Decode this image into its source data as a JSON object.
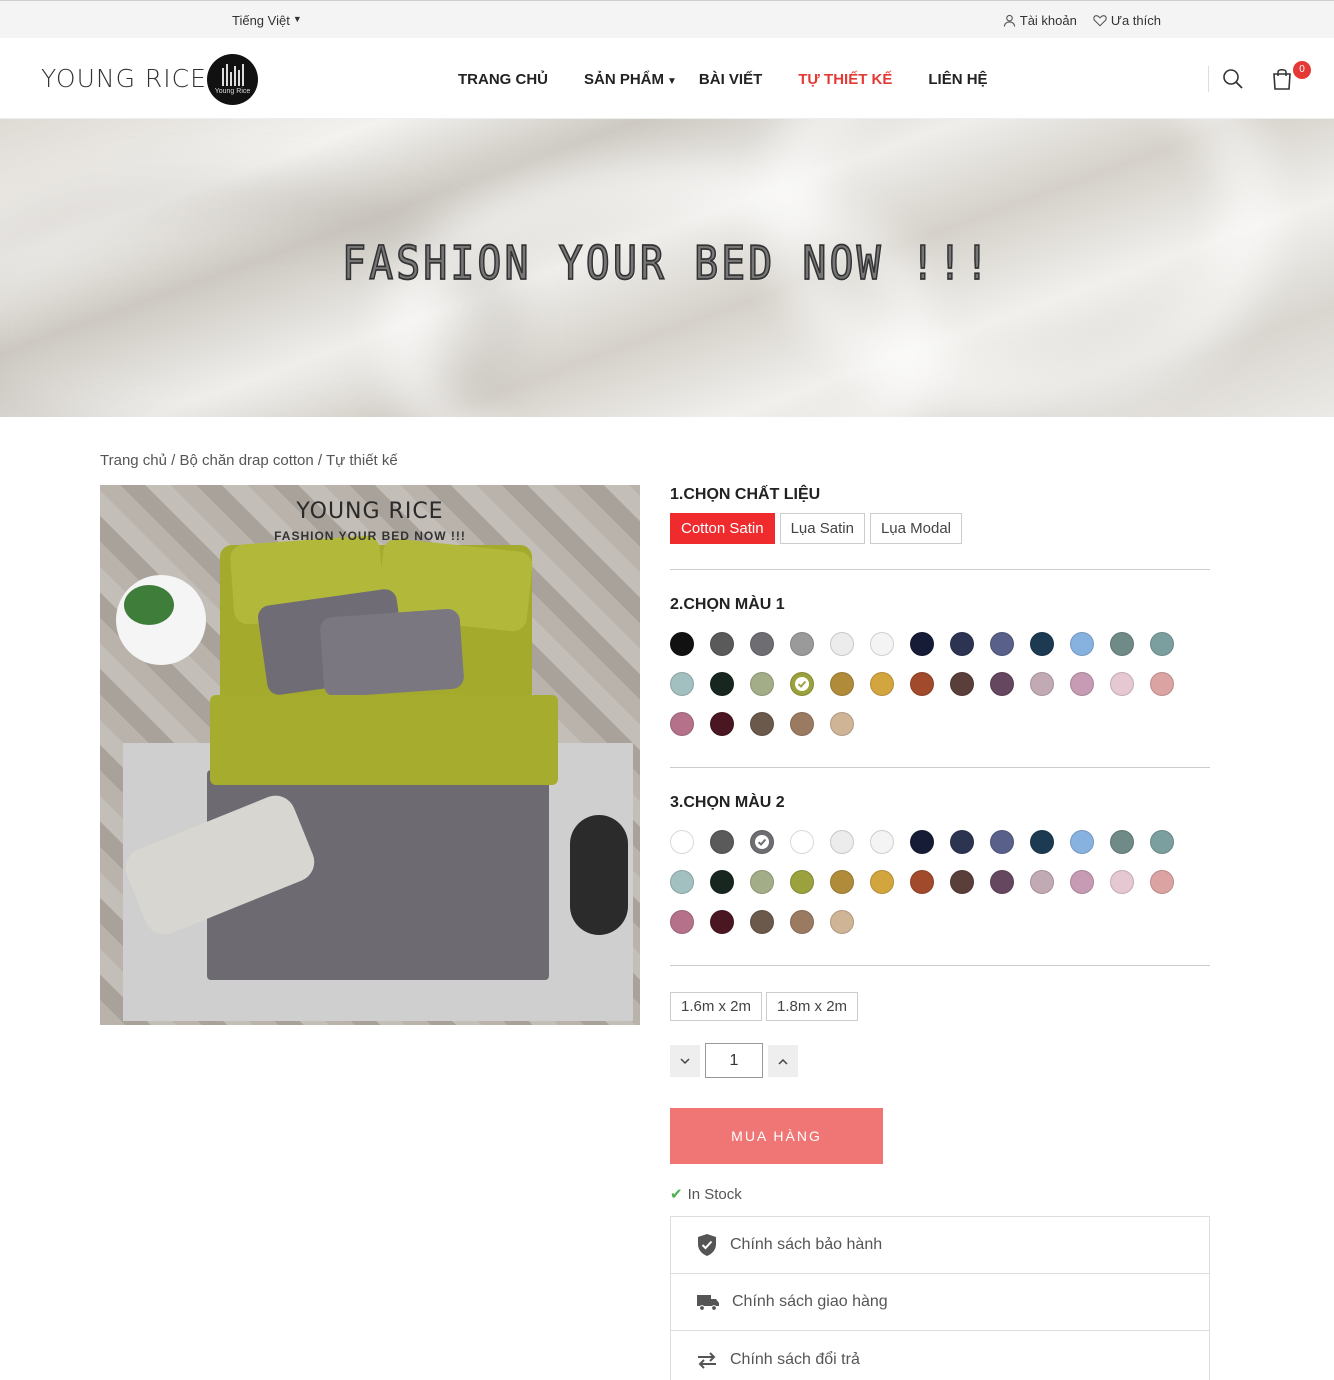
{
  "topbar": {
    "language": "Tiếng Việt",
    "account": "Tài khoản",
    "wishlist": "Ưa thích"
  },
  "header": {
    "logo_text": "YOUNG RICE",
    "logo_sub": "Young Rice",
    "nav": [
      "TRANG CHỦ",
      "SẢN PHẨM",
      "BÀI VIẾT",
      "TỰ THIẾT KẾ",
      "LIÊN HỆ"
    ],
    "active_nav": "TỰ THIẾT KẾ",
    "cart_count": "0",
    "icons": [
      "search-icon",
      "cart-icon"
    ]
  },
  "hero": {
    "title": "FASHION YOUR BED NOW !!!"
  },
  "breadcrumb": "Trang chủ / Bộ chăn drap cotton / Tự thiết kế",
  "product_image": {
    "brand": "YOUNG RICE",
    "tagline": "FASHION YOUR BED NOW !!!"
  },
  "material": {
    "title": "1.CHỌN CHẤT LIỆU",
    "options": [
      "Cotton Satin",
      "Lụa Satin",
      "Lụa Modal"
    ],
    "selected": "Cotton Satin"
  },
  "color1": {
    "title": "2.CHỌN MÀU 1",
    "selected_index": 16
  },
  "color2": {
    "title": "3.CHỌN MÀU 2",
    "selected_index": 2
  },
  "palette1": [
    "#111111",
    "#5a5a5a",
    "#6e6d72",
    "#9a9a9a",
    "#ececec",
    "#f4f4f4",
    "#161c36",
    "#2c3452",
    "#59608a",
    "#1c3a52",
    "#87b2e0",
    "#708a88",
    "#7b9f9e",
    "#a3c0c0",
    "#17261f",
    "#a3ae88",
    "#9ba13c",
    "#b08c3a",
    "#d3a53e",
    "#a24a2c",
    "#5a3e3a",
    "#65475f",
    "#c2aab5",
    "#c69bb3",
    "#e5c8d2",
    "#dca3a3",
    "#b5718a",
    "#4a1621",
    "#6b5a4c",
    "#9b7a62",
    "#cfb496"
  ],
  "palette2": [
    "#ffffff",
    "#5a5a5a",
    "#6e6d72",
    "#ffffff",
    "#ececec",
    "#f4f4f4",
    "#161c36",
    "#2c3452",
    "#59608a",
    "#1c3a52",
    "#87b2e0",
    "#708a88",
    "#7b9f9e",
    "#a3c0c0",
    "#17261f",
    "#a3ae88",
    "#9ba13c",
    "#b08c3a",
    "#d3a53e",
    "#a24a2c",
    "#5a3e3a",
    "#65475f",
    "#c2aab5",
    "#c69bb3",
    "#e5c8d2",
    "#dca3a3",
    "#b5718a",
    "#4a1621",
    "#6b5a4c",
    "#9b7a62",
    "#cfb496"
  ],
  "sizes": [
    "1.6m x 2m",
    "1.8m x 2m"
  ],
  "quantity": "1",
  "buy_label": "MUA HÀNG",
  "stock": "In Stock",
  "policies": [
    {
      "label": "Chính sách bảo hành",
      "icon": "shield-check-icon"
    },
    {
      "label": "Chính sách giao hàng",
      "icon": "truck-icon"
    },
    {
      "label": "Chính sách đổi trả",
      "icon": "exchange-arrows-icon"
    }
  ],
  "colors": {
    "accent": "#ef2b2d",
    "buy_button": "#f07575"
  }
}
